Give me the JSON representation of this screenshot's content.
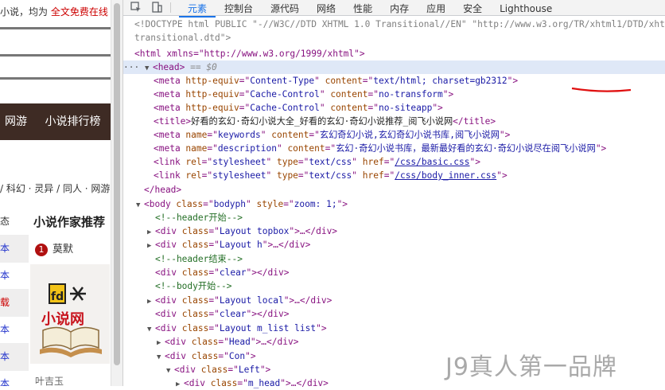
{
  "page": {
    "top_text": "小说，均为 ",
    "top_red": "全文免费在线",
    "nav_items": [
      "网游",
      "小说排行榜"
    ],
    "categories": "/ 科幻 · 灵异 / 同人 · 网游",
    "left_col": [
      "态",
      "本",
      "本",
      "载",
      "本",
      "本",
      "本"
    ],
    "writer_title": "小说作家推荐",
    "writer_rank": "1",
    "writer_name": "莫默",
    "logo_text": "小说网",
    "writer2": "叶吉玉"
  },
  "devtools": {
    "tabs": [
      "元素",
      "控制台",
      "源代码",
      "网络",
      "性能",
      "内存",
      "应用",
      "安全",
      "Lighthouse"
    ],
    "active_tab": "元素",
    "lines": {
      "doctype1": "<!DOCTYPE html PUBLIC \"-//W3C//DTD XHTML 1.0 Transitional//EN\" \"http://www.w3.org/TR/xhtml1/DTD/xhtml1-",
      "doctype2": "transitional.dtd\">",
      "html_open": "<html xmlns=\"http://www.w3.org/1999/xhtml\">",
      "head": "<head>",
      "eq": " == $0",
      "meta1_a": "<meta http-equiv=\"Content-Type\" content=\"text/html; charset=gb2312\">",
      "meta2": "<meta http-equiv=\"Cache-Control\" content=\"no-transform\">",
      "meta3": "<meta http-equiv=\"Cache-Control\" content=\"no-siteapp\">",
      "title_text": "好看的玄幻·奇幻小说大全_好看的玄幻·奇幻小说推荐_阅飞小说网",
      "keywords": "玄幻奇幻小说,玄幻奇幻小说书库,阅飞小说网",
      "description": "玄幻·奇幻小说书库，最新最好看的玄幻·奇幻小说尽在阅飞小说网",
      "css1": "/css/basic.css",
      "css2": "/css/body_inner.css",
      "head_close": "</head>",
      "body_open": "<body class=\"bodyph\" style=\"zoom: 1;\">",
      "c_header_start": "<!--header开始-->",
      "div_topbox": "<div class=\"Layout topbox\">…</div>",
      "div_h": "<div class=\"Layout h\">…</div>",
      "c_header_end": "<!--header结束-->",
      "div_clear1": "<div class=\"clear\"></div>",
      "c_body_start": "<!--body开始-->",
      "div_local": "<div class=\"Layout local\">…</div>",
      "div_clear2": "<div class=\"clear\"></div>",
      "div_mlist": "<div class=\"Layout m_list list\">",
      "div_head": "<div class=\"Head\">…</div>",
      "div_con": "<div class=\"Con\">",
      "div_left": "<div class=\"Left\">",
      "div_mhead": "<div class=\"m_head\">…</div>"
    },
    "watermark": "J9真人第一品牌"
  }
}
